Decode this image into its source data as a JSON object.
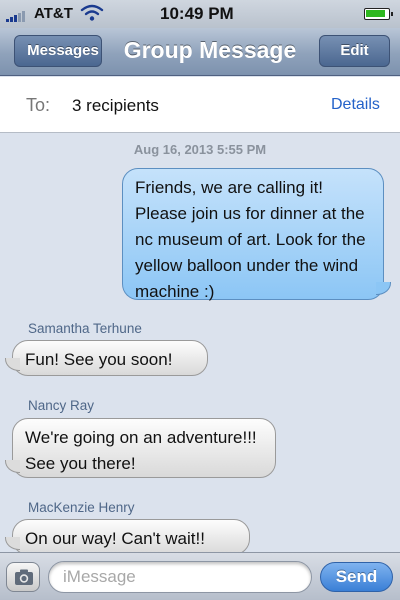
{
  "status_bar": {
    "carrier": "AT&T",
    "time": "10:49 PM",
    "signal_icon": "signal-bars-icon",
    "wifi_icon": "wifi-icon",
    "battery_icon": "battery-icon"
  },
  "nav": {
    "back_label": "Messages",
    "title": "Group Message",
    "edit_label": "Edit"
  },
  "recipients": {
    "label": "To:",
    "value": "3 recipients",
    "details_label": "Details"
  },
  "conversation": {
    "timestamp": "Aug 16, 2013 5:55 PM",
    "messages": [
      {
        "direction": "outgoing",
        "text": "Friends, we are calling it! Please join us for dinner at the nc museum of art. Look for the yellow balloon under the wind machine :)"
      },
      {
        "direction": "incoming",
        "sender": "Samantha Terhune",
        "text": "Fun! See you soon!"
      },
      {
        "direction": "incoming",
        "sender": "Nancy Ray",
        "text": "We're going on an adventure!!! See you there!"
      },
      {
        "direction": "incoming",
        "sender": "MacKenzie Henry",
        "text": "On our way! Can't wait!!"
      }
    ]
  },
  "compose": {
    "placeholder": "iMessage",
    "send_label": "Send",
    "camera_icon": "camera-icon"
  },
  "colors": {
    "nav_blue": "#7d92ae",
    "outgoing_bubble": "#8cc6f5",
    "incoming_bubble": "#d9d9d9",
    "send_button": "#3a7fd6",
    "link_blue": "#2462c9"
  }
}
